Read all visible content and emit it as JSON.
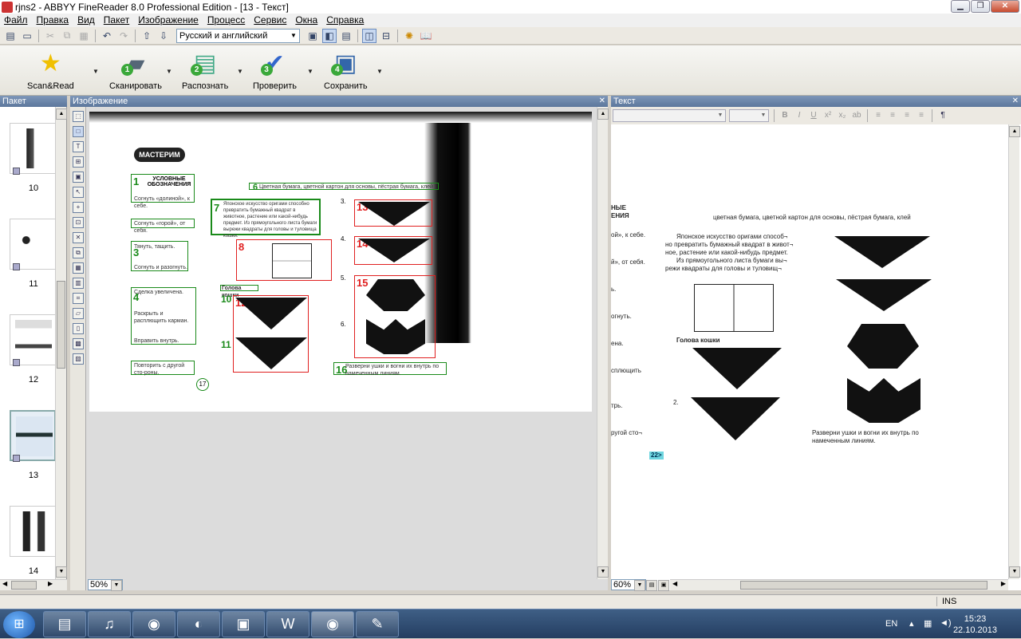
{
  "window": {
    "title": "rjns2 - ABBYY FineReader 8.0 Professional Edition - [13 - Текст]"
  },
  "menu": [
    "Файл",
    "Правка",
    "Вид",
    "Пакет",
    "Изображение",
    "Процесс",
    "Сервис",
    "Окна",
    "Справка"
  ],
  "toolbar": {
    "language": "Русский и английский"
  },
  "bigbuttons": [
    {
      "label": "Scan&Read",
      "num": ""
    },
    {
      "label": "Сканировать",
      "num": "1"
    },
    {
      "label": "Распознать",
      "num": "2"
    },
    {
      "label": "Проверить",
      "num": "3"
    },
    {
      "label": "Сохранить",
      "num": "4"
    }
  ],
  "panels": {
    "batch": "Пакет",
    "image": "Изображение",
    "text": "Текст"
  },
  "thumbnails": [
    {
      "num": "10"
    },
    {
      "num": "11"
    },
    {
      "num": "12"
    },
    {
      "num": "13"
    },
    {
      "num": "14"
    }
  ],
  "image": {
    "zoom": "50%",
    "logo": "МАСТЕРИМ",
    "legend_title": "УСЛОВНЫЕ ОБОЗНАЧЕНИЯ",
    "labels": [
      "Согнуть «долиной», к себе.",
      "Согнуть «горой», от себя.",
      "Тянуть, тащить.",
      "Согнуть и разогнуть.",
      "Сделка увеличена.",
      "Раскрыть и расплющить карман.",
      "Вправить внутрь.",
      "Повторить с другой сто-роны."
    ],
    "materials": "Цветная бумага, цветной картон для основы, пёстрая бумага, клей",
    "intro": "Японское искусство оригами способно превратить бумажный квадрат в животное, растение или какой-нибудь предмет. Из прямоугольного листа бумаги вырежи квадраты для головы и туловища кошки.",
    "head_label": "Голова кошки",
    "final": "Разверни ушки и вогни их внутрь по намеченным линиям.",
    "box_nums": [
      "1",
      "2",
      "3",
      "4",
      "5",
      "6",
      "7",
      "8",
      "9",
      "10",
      "11",
      "12",
      "13",
      "14",
      "15",
      "16",
      "17"
    ],
    "step_nums": [
      "3.",
      "4.",
      "5.",
      "6."
    ]
  },
  "text": {
    "zoom": "60%",
    "frag_top": "НЫЕ\nЕНИЯ",
    "materials": "цветная бумага, цветной картон для основы, пёстрая бумага, клей",
    "intro1": "Японское искусство оригами способ¬",
    "intro2": "но превратить бумажный квадрат в живот¬",
    "intro3": "ное, растение или какой-нибудь предмет.",
    "intro4": "Из прямоугольного листа бумаги вы¬",
    "intro5": "режи квадраты для головы и туловищ¬",
    "left_frags": [
      "ой», к себе.",
      "й», от себя.",
      "ь.",
      "огнуть.",
      "ена.",
      "сплющить",
      "трь.",
      "ругой сто¬"
    ],
    "head_label": "Голова кошки",
    "step2": "2.",
    "final": "Разверни ушки и вогни их внутрь по намеченным линиям.",
    "page_ref": "22>"
  },
  "status": {
    "ins": "INS"
  },
  "taskbar": {
    "lang": "EN",
    "time": "15:23",
    "date": "22.10.2013"
  }
}
